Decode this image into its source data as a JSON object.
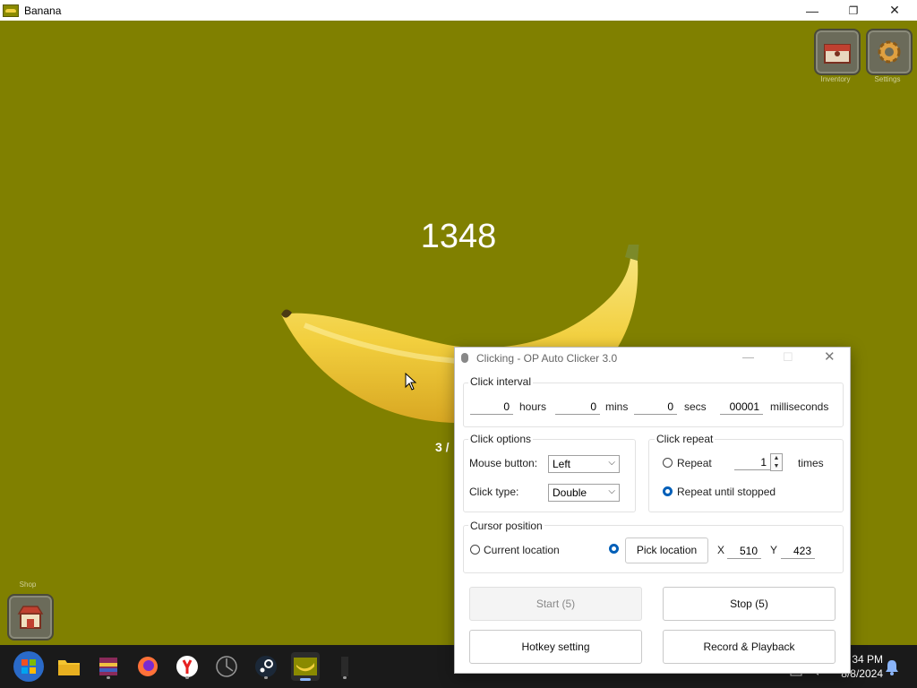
{
  "window": {
    "title": "Banana",
    "minimize": "—",
    "maximize": "❐",
    "close": "✕"
  },
  "game": {
    "counter": "1348",
    "sub_count": "3 /",
    "inventory_label": "Inventory",
    "settings_label": "Settings",
    "shop_label": "Shop"
  },
  "dialog": {
    "title": "Clicking - OP Auto Clicker 3.0",
    "interval": {
      "title": "Click interval",
      "hours": "0",
      "hours_label": "hours",
      "mins": "0",
      "mins_label": "mins",
      "secs": "0",
      "secs_label": "secs",
      "ms": "00001",
      "ms_label": "milliseconds"
    },
    "options": {
      "title": "Click options",
      "mouse_button_label": "Mouse button:",
      "mouse_button_value": "Left",
      "click_type_label": "Click type:",
      "click_type_value": "Double"
    },
    "repeat": {
      "title": "Click repeat",
      "repeat_label": "Repeat",
      "repeat_count": "1",
      "times_label": "times",
      "until_stopped_label": "Repeat until stopped",
      "selected": "until_stopped"
    },
    "cursor": {
      "title": "Cursor position",
      "current_label": "Current location",
      "pick_label": "Pick location",
      "x_label": "X",
      "x_value": "510",
      "y_label": "Y",
      "y_value": "423",
      "selected": "pick"
    },
    "buttons": {
      "start": "Start (5)",
      "stop": "Stop (5)",
      "hotkey": "Hotkey setting",
      "record": "Record & Playback"
    }
  },
  "taskbar": {
    "time": "34 PM",
    "date": "8/8/2024"
  },
  "colors": {
    "game_bg": "#808000",
    "accent": "#005fb8"
  }
}
